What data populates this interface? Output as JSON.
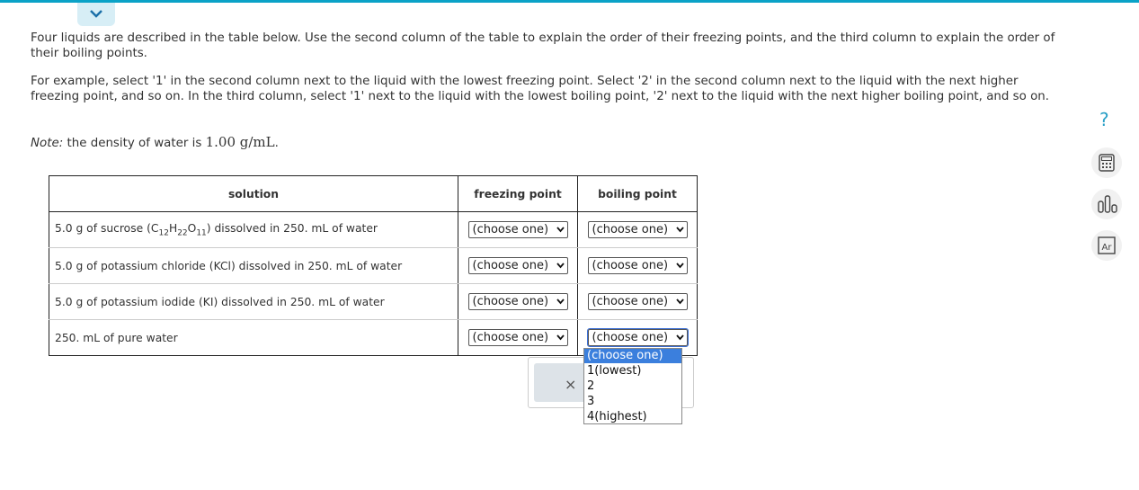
{
  "prose": {
    "intro": "Four liquids are described in the table below. Use the second column of the table to explain the order of their freezing points, and the third column to explain the order of their boiling points.",
    "example": "For example, select '1' in the second column next to the liquid with the lowest freezing point. Select '2' in the second column next to the liquid with the next higher freezing point, and so on. In the third column, select '1' next to the liquid with the lowest boiling point, '2' next to the liquid with the next higher boiling point, and so on.",
    "note_label": "Note:",
    "note_text": " the density of water is ",
    "note_value": "1.00 g/mL",
    "note_end": "."
  },
  "table": {
    "headers": {
      "solution": "solution",
      "freezing": "freezing point",
      "boiling": "boiling point"
    },
    "rows": [
      {
        "pre": "5.0 g of sucrose (C",
        "s1": "12",
        "h": "H",
        "s2": "22",
        "o": "O",
        "s3": "11",
        "post": ") dissolved in 250. mL of water",
        "fp": "(choose one)",
        "bp": "(choose one)"
      },
      {
        "text": "5.0 g of potassium chloride (KCl) dissolved in 250. mL of water",
        "fp": "(choose one)",
        "bp": "(choose one)"
      },
      {
        "text": "5.0 g of potassium iodide (KI) dissolved in 250. mL of water",
        "fp": "(choose one)",
        "bp": "(choose one)"
      },
      {
        "text": "250. mL of pure water",
        "fp": "(choose one)",
        "bp": "(choose one)"
      }
    ]
  },
  "dropdown": {
    "options": [
      "(choose one)",
      "1(lowest)",
      "2",
      "3",
      "4(highest)"
    ],
    "selected_index": 0
  },
  "feedback": {
    "close_glyph": "×"
  },
  "sidebar": {
    "help_glyph": "?",
    "ptable_label": "Ar"
  },
  "colors": {
    "accent": "#0aa2c7",
    "selected_option": "#3b7fdd"
  }
}
